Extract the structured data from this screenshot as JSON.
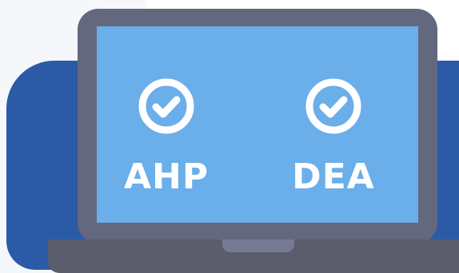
{
  "screen": {
    "items": [
      {
        "label": "AHP",
        "icon": "check-circle-icon"
      },
      {
        "label": "DEA",
        "icon": "check-circle-icon"
      }
    ]
  },
  "colors": {
    "accent_blue": "#2b5aa6",
    "screen_blue": "#6aaeea",
    "laptop_gray": "#64687e",
    "laptop_base": "#5b5d6d",
    "icon_white": "#ffffff"
  }
}
